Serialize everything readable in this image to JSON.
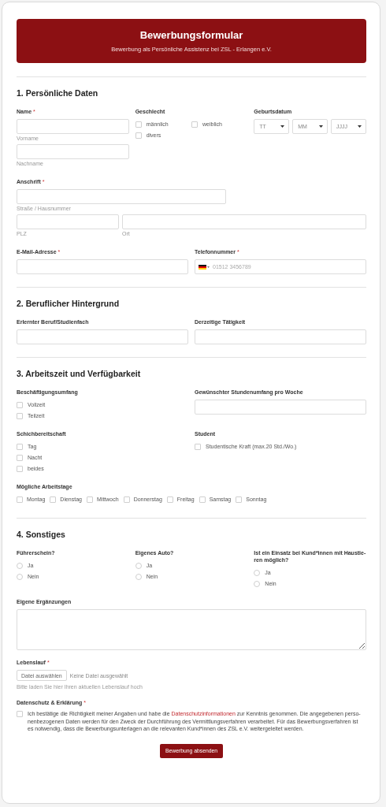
{
  "header": {
    "title": "Bewerbungsformular",
    "subtitle": "Bewerbung als Persönliche Assistenz bei ZSL - Erlangen e.V."
  },
  "sections": [
    {
      "title": "1. Persönliche Daten",
      "rows": [
        {
          "fields": [
            {
              "kind": "input",
              "label": "Name",
              "required_mark": "*",
              "inputs": [
                {
                  "sublabel": "Vorname"
                },
                {
                  "sublabel": "Nachname"
                }
              ]
            },
            {
              "kind": "checkgrid",
              "label": "Geschlecht",
              "options": [
                {
                  "label": "männlich",
                  "checked": false
                },
                {
                  "label": "weiblich",
                  "checked": false
                },
                {
                  "label": "divers",
                  "checked": false
                }
              ]
            },
            {
              "kind": "date",
              "label": "Geburtsdatum",
              "selects": [
                "TT",
                "MM",
                "JJJJ"
              ]
            }
          ]
        },
        {
          "fields": [
            {
              "kind": "address",
              "label": "Anschrift",
              "required_mark": "*",
              "inputs": [
                {
                  "sublabel": "Straße / Hausnummer"
                },
                {
                  "sublabel": "PLZ"
                },
                {
                  "sublabel": "Ort"
                }
              ]
            }
          ]
        },
        {
          "fields": [
            {
              "kind": "input",
              "label": "E-Mail-Adresse",
              "required_mark": "*"
            },
            {
              "kind": "phone",
              "label": "Telefonnummer",
              "required_mark": "*",
              "placeholder": "01512 3456789"
            }
          ]
        }
      ]
    },
    {
      "title": "2. Beruflicher Hintergrund",
      "rows": [
        {
          "fields": [
            {
              "kind": "input",
              "label": "Erlernter Beruf/Studienfach"
            },
            {
              "kind": "input",
              "label": "Derzeitige Tätigkeit"
            }
          ]
        }
      ]
    },
    {
      "title": "3. Arbeitszeit und Verfügbarkeit",
      "rows": [
        {
          "fields": [
            {
              "kind": "checklist",
              "label": "Beschäftigungsumfang",
              "options": [
                {
                  "label": "Vollzeit",
                  "checked": false
                },
                {
                  "label": "Teilzeit",
                  "checked": false
                }
              ]
            },
            {
              "kind": "input",
              "label": "Gewünschter Stundenumfang pro Woche"
            }
          ]
        },
        {
          "fields": [
            {
              "kind": "checklist",
              "label": "Schichbereitschaft",
              "options": [
                {
                  "label": "Tag",
                  "checked": false
                },
                {
                  "label": "Nacht",
                  "checked": false
                },
                {
                  "label": "beides",
                  "checked": false
                }
              ]
            },
            {
              "kind": "checklist",
              "label": "Student",
              "options": [
                {
                  "label": "Studentische Kraft (max.20 Std./Wo.)",
                  "checked": false
                }
              ]
            }
          ]
        },
        {
          "fields": [
            {
              "kind": "checkrow",
              "label": "Mögliche Arbeitstage",
              "options": [
                {
                  "label": "Montag",
                  "checked": false
                },
                {
                  "label": "Dienstag",
                  "checked": false
                },
                {
                  "label": "Mittwoch",
                  "checked": false
                },
                {
                  "label": "Donnerstag",
                  "checked": false
                },
                {
                  "label": "Freitag",
                  "checked": false
                },
                {
                  "label": "Samstag",
                  "checked": false
                },
                {
                  "label": "Sonntag",
                  "checked": false
                }
              ]
            }
          ]
        }
      ]
    },
    {
      "title": "4. Sonstiges",
      "rows": [
        {
          "fields": [
            {
              "kind": "radios",
              "label": "Führerschein?",
              "options": [
                {
                  "label": "Ja",
                  "selected": false
                },
                {
                  "label": "Nein",
                  "selected": false
                }
              ]
            },
            {
              "kind": "radios",
              "label": "Eigenes Auto?",
              "options": [
                {
                  "label": "Ja",
                  "selected": false
                },
                {
                  "label": "Nein",
                  "selected": false
                }
              ]
            },
            {
              "kind": "radios",
              "label": "Ist ein Einsatz bei Kund*innen mit Haustie-ren möglich?",
              "options": [
                {
                  "label": "Ja",
                  "selected": false
                },
                {
                  "label": "Nein",
                  "selected": false
                }
              ]
            }
          ]
        },
        {
          "fields": [
            {
              "kind": "textarea",
              "label": "Eigene Ergänzungen"
            }
          ]
        },
        {
          "fields": [
            {
              "kind": "file",
              "label": "Lebenslauf",
              "required_mark": "*",
              "button": "Datei auswählen",
              "status": "Keine Datei ausgewählt",
              "hint": "Bitte laden Sie hier Ihren aktuellen Lebenslauf hoch"
            }
          ]
        },
        {
          "fields": [
            {
              "kind": "consent",
              "label": "Datenschutz & Erklärung",
              "required_mark": "*",
              "checked": false,
              "text_before": "Ich bestätige die Richtigkeit meiner Angaben und habe die ",
              "link": "Datenschutzinformationen",
              "text_after": " zur Kenntnis genommen. Die angegebenen perso-nenbezogenen Daten werden für den Zweck der Durchführung des Vermittlungsverfahren verarbeitet. Für das Bewerbungsverfahren ist es notwendig, dass die Bewerbungsunterlagen an die relevanten Kund*innen des ZSL e.V. weitergeleitet werden."
            }
          ]
        }
      ]
    }
  ],
  "submit": "Bewerbung absenden"
}
